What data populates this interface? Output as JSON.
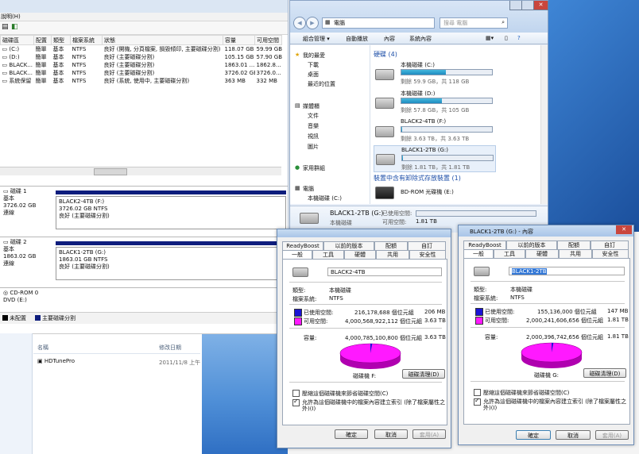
{
  "disk_mgmt": {
    "menu_fragment": "說明(H)",
    "columns": [
      "磁碟區",
      "配置",
      "類型",
      "檔案系統",
      "狀態",
      "容量",
      "可用空間"
    ],
    "rows": [
      [
        "(C:)",
        "簡單",
        "基本",
        "NTFS",
        "良好 (開機, 分頁檔案, 損毀傾印, 主要磁碟分割)",
        "118.07 GB",
        "59.99 GB"
      ],
      [
        "(D:)",
        "簡單",
        "基本",
        "NTFS",
        "良好 (主要磁碟分割)",
        "105.15 GB",
        "57.90 GB"
      ],
      [
        "BLACK...",
        "簡單",
        "基本",
        "NTFS",
        "良好 (主要磁碟分割)",
        "1863.01 ...",
        "1862.8..."
      ],
      [
        "BLACK...",
        "簡單",
        "基本",
        "NTFS",
        "良好 (主要磁碟分割)",
        "3726.02 GB",
        "3726.0..."
      ],
      [
        "系統保留",
        "簡單",
        "基本",
        "NTFS",
        "良好 (系統, 使用中, 主要磁碟分割)",
        "363 MB",
        "332 MB"
      ]
    ],
    "disk1": {
      "name": "磁碟 1",
      "type": "基本",
      "size": "3726.02 GB",
      "status": "連線",
      "vol_name": "BLACK2-4TB (F:)",
      "vol_size": "3726.02 GB NTFS",
      "vol_status": "良好 (主要磁碟分割)"
    },
    "disk2": {
      "name": "磁碟 2",
      "type": "基本",
      "size": "1863.02 GB",
      "status": "連線",
      "vol_name": "BLACK1-2TB (G:)",
      "vol_size": "1863.01 GB NTFS",
      "vol_status": "良好 (主要磁碟分割)"
    },
    "cdrom": {
      "name": "CD-ROM 0",
      "type": "DVD (E:)"
    },
    "legend": {
      "unallocated": "未配置",
      "primary": "主要磁碟分割"
    }
  },
  "explorer": {
    "address": "電腦",
    "search_placeholder": "搜尋 電腦",
    "toolbar": [
      "組合管理 ▾",
      "自動播放",
      "內容",
      "系統內容",
      "解除安裝或變更程式"
    ],
    "nav": {
      "favorites": "我的最愛",
      "downloads": "下載",
      "desktop": "桌面",
      "recent": "最近的位置",
      "libraries": "媒體櫃",
      "documents": "文件",
      "music": "音樂",
      "videos": "視訊",
      "pictures": "圖片",
      "homegroup": "家用群組",
      "computer": "電腦",
      "local_c": "本機磁碟 (C:)"
    },
    "hdd_header": "硬碟 (4)",
    "drives": [
      {
        "name": "本機磁碟 (C:)",
        "free": "剩餘 59.9 GB，共 118 GB",
        "used_pct": 49
      },
      {
        "name": "本機磁碟 (D:)",
        "free": "剩餘 57.8 GB，共 105 GB",
        "used_pct": 45
      },
      {
        "name": "BLACK2-4TB (F:)",
        "free": "剩餘 3.63 TB，共 3.63 TB",
        "used_pct": 1
      },
      {
        "name": "BLACK1-2TB (G:)",
        "free": "剩餘 1.81 TB，共 1.81 TB",
        "used_pct": 1
      }
    ],
    "removable_header": "裝置中含有卸除式存放裝置 (1)",
    "bdrom": "BD-ROM 光碟機 (E:)",
    "details": {
      "name": "BLACK1-2TB (G:)",
      "kind": "本機磁碟",
      "used_label": "已使用空間:",
      "free_label": "可用空間:",
      "free_value": "1.81 TB"
    }
  },
  "lower_list": {
    "col_name": "名稱",
    "col_date": "修改日期",
    "item": "HDTunePro",
    "item_date": "2011/11/8 上午"
  },
  "props_f": {
    "tabs_top": [
      "ReadyBoost",
      "以前的版本",
      "配額",
      "自訂"
    ],
    "tabs_bottom": [
      "一般",
      "工具",
      "硬體",
      "共用",
      "安全性"
    ],
    "name": "BLACK2-4TB",
    "type_label": "類型:",
    "type_value": "本機磁碟",
    "fs_label": "檔案系統:",
    "fs_value": "NTFS",
    "used_label": "已使用空間:",
    "used_bytes": "216,178,688 個位元組",
    "used_h": "206 MB",
    "free_label": "可用空間:",
    "free_bytes": "4,000,568,922,112 個位元組",
    "free_h": "3.63 TB",
    "cap_label": "容量:",
    "cap_bytes": "4,000,785,100,800 個位元組",
    "cap_h": "3.63 TB",
    "drive_label": "磁碟機 F:",
    "cleanup": "磁碟清理(D)",
    "compress": "壓縮這個磁碟機來節省磁碟空間(C)",
    "index": "允許為這個磁碟機中的檔案內容建立索引 (除了檔案屬性之外)(I)",
    "ok": "確定",
    "cancel": "取消",
    "apply": "套用(A)",
    "used_fraction": 0.01
  },
  "props_g": {
    "title": "BLACK1-2TB (G:) - 內容",
    "tabs_top": [
      "ReadyBoost",
      "以前的版本",
      "配額",
      "自訂"
    ],
    "tabs_bottom": [
      "一般",
      "工具",
      "硬體",
      "共用",
      "安全性"
    ],
    "name": "BLACK1-2TB",
    "type_label": "類型:",
    "type_value": "本機磁碟",
    "fs_label": "檔案系統:",
    "fs_value": "NTFS",
    "used_label": "已使用空間:",
    "used_bytes": "155,136,000 個位元組",
    "used_h": "147 MB",
    "free_label": "可用空間:",
    "free_bytes": "2,000,241,606,656 個位元組",
    "free_h": "1.81 TB",
    "cap_label": "容量:",
    "cap_bytes": "2,000,396,742,656 個位元組",
    "cap_h": "1.81 TB",
    "drive_label": "磁碟機 G:",
    "cleanup": "磁碟清理(D)",
    "compress": "壓縮這個磁碟機來節省磁碟空間(C)",
    "index": "允許為這個磁碟機中的檔案內容建立索引 (除了檔案屬性之外)(I)",
    "ok": "確定",
    "cancel": "取消",
    "apply": "套用(A)",
    "used_fraction": 0.01
  },
  "colors": {
    "used": "#1a14d6",
    "free": "#ff19ff",
    "disk_bar": "#0e1d7d"
  }
}
